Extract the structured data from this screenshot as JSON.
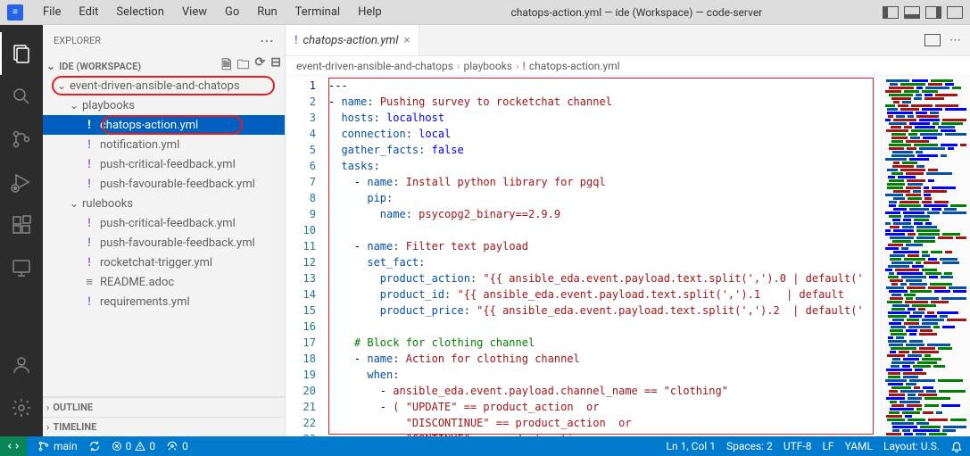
{
  "window": {
    "title": "chatops-action.yml — ide (Workspace) — code-server"
  },
  "menu": [
    "File",
    "Edit",
    "Selection",
    "View",
    "Go",
    "Run",
    "Terminal",
    "Help"
  ],
  "sidebar": {
    "title": "Explorer",
    "workspace": "IDE (WORKSPACE)",
    "tree": {
      "root": "event-driven-ansible-and-chatops",
      "folders": {
        "playbooks": "playbooks",
        "rulebooks": "rulebooks"
      },
      "files": {
        "chatops": "chatops-action.yml",
        "notification": "notification.yml",
        "pushcrit1": "push-critical-feedback.yml",
        "pushfav1": "push-favourable-feedback.yml",
        "pushcrit2": "push-critical-feedback.yml",
        "pushfav2": "push-favourable-feedback.yml",
        "rocket": "rocketchat-trigger.yml",
        "readme": "README.adoc",
        "req": "requirements.yml"
      }
    },
    "outline": "Outline",
    "timeline": "Timeline"
  },
  "tabs": {
    "active": "chatops-action.yml"
  },
  "breadcrumb": {
    "seg1": "event-driven-ansible-and-chatops",
    "seg2": "playbooks",
    "seg3": "chatops-action.yml"
  },
  "code": {
    "lines": [
      {
        "n": 1,
        "segs": [
          {
            "t": "---",
            "c": "tk-dash"
          }
        ]
      },
      {
        "n": 2,
        "segs": [
          {
            "t": "- ",
            "c": "tk-dash"
          },
          {
            "t": "name",
            "c": "tk-key"
          },
          {
            "t": ": ",
            "c": "tk-text"
          },
          {
            "t": "Pushing survey to rocketchat channel",
            "c": "tk-str"
          }
        ]
      },
      {
        "n": 3,
        "segs": [
          {
            "t": "  ",
            "c": ""
          },
          {
            "t": "hosts",
            "c": "tk-key"
          },
          {
            "t": ": ",
            "c": "tk-text"
          },
          {
            "t": "localhost",
            "c": "tk-id"
          }
        ]
      },
      {
        "n": 4,
        "segs": [
          {
            "t": "  ",
            "c": ""
          },
          {
            "t": "connection",
            "c": "tk-key"
          },
          {
            "t": ": ",
            "c": "tk-text"
          },
          {
            "t": "local",
            "c": "tk-id"
          }
        ]
      },
      {
        "n": 5,
        "segs": [
          {
            "t": "  ",
            "c": ""
          },
          {
            "t": "gather_facts",
            "c": "tk-key"
          },
          {
            "t": ": ",
            "c": "tk-text"
          },
          {
            "t": "false",
            "c": "tk-bool"
          }
        ]
      },
      {
        "n": 6,
        "segs": [
          {
            "t": "  ",
            "c": ""
          },
          {
            "t": "tasks",
            "c": "tk-key"
          },
          {
            "t": ":",
            "c": "tk-text"
          }
        ]
      },
      {
        "n": 7,
        "segs": [
          {
            "t": "    - ",
            "c": "tk-dash"
          },
          {
            "t": "name",
            "c": "tk-key"
          },
          {
            "t": ": ",
            "c": "tk-text"
          },
          {
            "t": "Install python library for pgql",
            "c": "tk-str"
          }
        ]
      },
      {
        "n": 8,
        "segs": [
          {
            "t": "      ",
            "c": ""
          },
          {
            "t": "pip",
            "c": "tk-key"
          },
          {
            "t": ":",
            "c": "tk-text"
          }
        ]
      },
      {
        "n": 9,
        "segs": [
          {
            "t": "        ",
            "c": ""
          },
          {
            "t": "name",
            "c": "tk-key"
          },
          {
            "t": ": ",
            "c": "tk-text"
          },
          {
            "t": "psycopg2_binary==2.9.9",
            "c": "tk-str"
          }
        ]
      },
      {
        "n": 10,
        "segs": []
      },
      {
        "n": 11,
        "segs": [
          {
            "t": "    - ",
            "c": "tk-dash"
          },
          {
            "t": "name",
            "c": "tk-key"
          },
          {
            "t": ": ",
            "c": "tk-text"
          },
          {
            "t": "Filter text payload",
            "c": "tk-str"
          }
        ]
      },
      {
        "n": 12,
        "segs": [
          {
            "t": "      ",
            "c": ""
          },
          {
            "t": "set_fact",
            "c": "tk-key"
          },
          {
            "t": ":",
            "c": "tk-text"
          }
        ]
      },
      {
        "n": 13,
        "segs": [
          {
            "t": "        ",
            "c": ""
          },
          {
            "t": "product_action",
            "c": "tk-key"
          },
          {
            "t": ": ",
            "c": "tk-text"
          },
          {
            "t": "\"{{ ansible_eda.event.payload.text.split(',').0 | default('",
            "c": "tk-str"
          }
        ]
      },
      {
        "n": 14,
        "segs": [
          {
            "t": "        ",
            "c": ""
          },
          {
            "t": "product_id",
            "c": "tk-key"
          },
          {
            "t": ": ",
            "c": "tk-text"
          },
          {
            "t": "\"{{ ansible_eda.event.payload.text.split(',').1    | default",
            "c": "tk-str"
          }
        ]
      },
      {
        "n": 15,
        "segs": [
          {
            "t": "        ",
            "c": ""
          },
          {
            "t": "product_price",
            "c": "tk-key"
          },
          {
            "t": ": ",
            "c": "tk-text"
          },
          {
            "t": "\"{{ ansible_eda.event.payload.text.split(',').2  | default('",
            "c": "tk-str"
          }
        ]
      },
      {
        "n": 16,
        "segs": []
      },
      {
        "n": 17,
        "segs": [
          {
            "t": "    ",
            "c": ""
          },
          {
            "t": "# Block for clothing channel",
            "c": "tk-comment"
          }
        ]
      },
      {
        "n": 18,
        "segs": [
          {
            "t": "    - ",
            "c": "tk-dash"
          },
          {
            "t": "name",
            "c": "tk-key"
          },
          {
            "t": ": ",
            "c": "tk-text"
          },
          {
            "t": "Action for clothing channel",
            "c": "tk-str"
          }
        ]
      },
      {
        "n": 19,
        "segs": [
          {
            "t": "      ",
            "c": ""
          },
          {
            "t": "when",
            "c": "tk-key"
          },
          {
            "t": ":",
            "c": "tk-text"
          }
        ]
      },
      {
        "n": 20,
        "segs": [
          {
            "t": "        - ",
            "c": "tk-dash"
          },
          {
            "t": "ansible_eda.event.payload.channel_name == \"clothing\"",
            "c": "tk-str"
          }
        ]
      },
      {
        "n": 21,
        "segs": [
          {
            "t": "        - ",
            "c": "tk-dash"
          },
          {
            "t": "( \"UPDATE\" == product_action  or",
            "c": "tk-str"
          }
        ]
      },
      {
        "n": 22,
        "segs": [
          {
            "t": "            ",
            "c": ""
          },
          {
            "t": "\"DISCONTINUE\" == product_action  or",
            "c": "tk-str"
          }
        ]
      },
      {
        "n": 23,
        "segs": [
          {
            "t": "            ",
            "c": ""
          },
          {
            "t": "\"CONTINUE\" == product_action",
            "c": "tk-str"
          }
        ]
      }
    ]
  },
  "status": {
    "remote": "",
    "branch": "main",
    "sync": "",
    "errors": "0",
    "warnings": "0",
    "ports": "0",
    "ln": "Ln 1, Col 1",
    "spaces": "Spaces: 2",
    "encoding": "UTF-8",
    "eol": "LF",
    "lang": "YAML",
    "layout": "Layout: U.S.",
    "bell": ""
  }
}
